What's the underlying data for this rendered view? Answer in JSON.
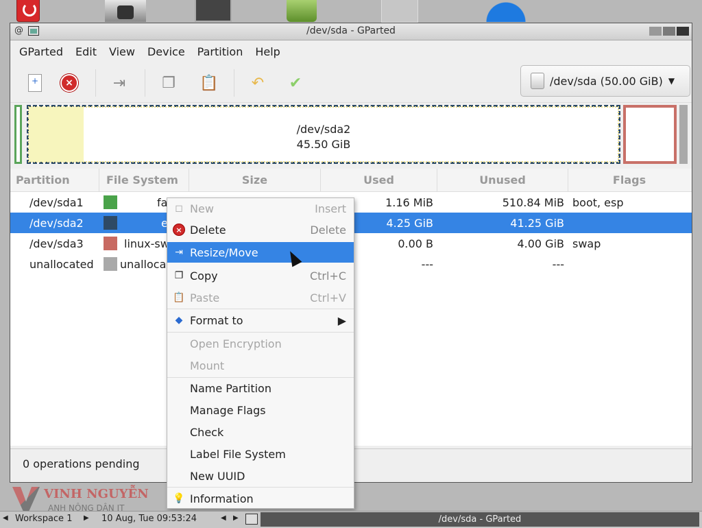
{
  "window": {
    "title": "/dev/sda - GParted"
  },
  "menubar": [
    "GParted",
    "Edit",
    "View",
    "Device",
    "Partition",
    "Help"
  ],
  "device_selector": {
    "label": "/dev/sda (50.00 GiB)"
  },
  "disk_map": {
    "selected_name": "/dev/sda2",
    "selected_size": "45.50 GiB"
  },
  "table": {
    "headers": [
      "Partition",
      "File System",
      "Size",
      "Used",
      "Unused",
      "Flags"
    ],
    "rows": [
      {
        "partition": "/dev/sda1",
        "fs": "fa",
        "fs_color": "#4aa34a",
        "used": "1.16 MiB",
        "unused": "510.84 MiB",
        "flags": "boot, esp"
      },
      {
        "partition": "/dev/sda2",
        "fs": "e",
        "fs_color": "#2e4a66",
        "used": "4.25 GiB",
        "unused": "41.25 GiB",
        "flags": ""
      },
      {
        "partition": "/dev/sda3",
        "fs": "linux-sw",
        "fs_color": "#c86a62",
        "used": "0.00 B",
        "unused": "4.00 GiB",
        "flags": "swap"
      },
      {
        "partition": "unallocated",
        "fs": "unalloca",
        "fs_color": "#a9a9a9",
        "used": "---",
        "unused": "---",
        "flags": ""
      }
    ]
  },
  "status": {
    "text": "0 operations pending"
  },
  "context_menu": {
    "new": {
      "label": "New",
      "accel": "Insert"
    },
    "delete": {
      "label": "Delete",
      "accel": "Delete"
    },
    "resize": {
      "label": "Resize/Move"
    },
    "copy": {
      "label": "Copy",
      "accel": "Ctrl+C"
    },
    "paste": {
      "label": "Paste",
      "accel": "Ctrl+V"
    },
    "format": {
      "label": "Format to"
    },
    "open_encryption": {
      "label": "Open Encryption"
    },
    "mount": {
      "label": "Mount"
    },
    "name_partition": {
      "label": "Name Partition"
    },
    "manage_flags": {
      "label": "Manage Flags"
    },
    "check": {
      "label": "Check"
    },
    "label_fs": {
      "label": "Label File System"
    },
    "new_uuid": {
      "label": "New UUID"
    },
    "information": {
      "label": "Information"
    }
  },
  "watermark": {
    "name": "VINH NGUYỄN",
    "sub": "ANH NÔNG DÂN IT"
  },
  "taskbar": {
    "workspace": "Workspace 1",
    "clock": "10 Aug, Tue 09:53:24",
    "task": "/dev/sda - GParted"
  }
}
